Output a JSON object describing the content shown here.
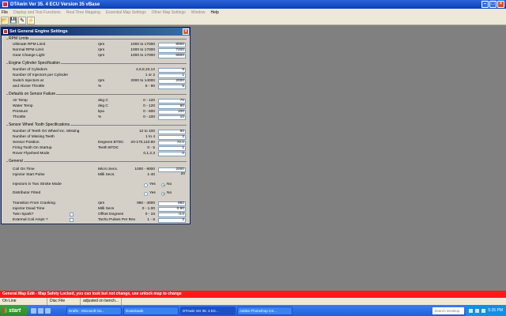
{
  "app": {
    "title": "DTAwin Ver  35. 4 ECU Version  35 vBase",
    "menu": [
      "File",
      "Display and Test Functions",
      "Real Time Mapping",
      "Essential Map Settings",
      "Other Map Settings",
      "Window",
      "Help"
    ],
    "menu_active": [
      true,
      false,
      false,
      false,
      false,
      false,
      true
    ]
  },
  "dialog": {
    "title": "Set General Engine Settings",
    "groups": {
      "rpm": {
        "title": "RPM Limits",
        "rows": [
          {
            "label": "Ultimate RPM Limit",
            "unit": "rpm",
            "range": "1000 to  17000",
            "value": "8000"
          },
          {
            "label": "Normal RPM Limit",
            "unit": "rpm",
            "range": "1000 to  17000",
            "value": "7200"
          },
          {
            "label": "Gear Change Light",
            "unit": "rpm",
            "range": "1000 to  17000",
            "value": "6500"
          }
        ]
      },
      "cyl": {
        "title": "Engine Cylinder Specification",
        "rows": [
          {
            "label": "Number of Cylinders",
            "unit": "",
            "range": "4,6,8,10,12",
            "value": "8"
          },
          {
            "label": "Number Of Injectors per Cylinder",
            "unit": "",
            "range": "1 or 2",
            "value": "1"
          },
          {
            "label": "Switch Injectors at",
            "unit": "rpm",
            "range": "2000 to 14000",
            "value": "2000"
          },
          {
            "label": "and Above Throttle",
            "unit": "%",
            "range": "5 - 90",
            "value": "5"
          }
        ]
      },
      "def": {
        "title": "Defaults on Sensor Failure",
        "rows": [
          {
            "label": "Air Temp",
            "unit": "deg C",
            "range": "0 - 120",
            "value": "70"
          },
          {
            "label": "Water Temp",
            "unit": "deg C",
            "range": "0 - 120",
            "value": "90"
          },
          {
            "label": "Pressure",
            "unit": "kpa",
            "range": "0 - 600",
            "value": "100"
          },
          {
            "label": "Throttle",
            "unit": "%",
            "range": "0 - 100",
            "value": "10"
          }
        ]
      },
      "wheel": {
        "title": "Sensor Wheel Tooth Specifications",
        "rows": [
          {
            "label": "Number of Teeth On Wheel inc. Missing",
            "unit": "",
            "range": "12 to 100",
            "value": "60"
          },
          {
            "label": "Number of Missing Teeth",
            "unit": "",
            "range": "1 to 4",
            "value": "2"
          },
          {
            "label": "Sensor Position",
            "unit": "Degrees BTDC",
            "range": "20-170,110.80",
            "value": "70.0"
          },
          {
            "label": "Firing Tooth On Startup",
            "unit": "Teeth BTDC",
            "range": "0 - 5",
            "value": "1"
          },
          {
            "label": "Rover Flywheel Mode",
            "unit": "",
            "range": "0,1,2,3",
            "value": "0"
          }
        ]
      },
      "general": {
        "title": "General",
        "coil": {
          "label": "Coil On Time",
          "unit": "Micro Secs.",
          "range": "1000 - 9000",
          "value": "2000"
        },
        "start": {
          "label": "Injector Start Pulse",
          "unit": "Milli Secs.",
          "range": "1-40",
          "value": "20"
        },
        "two_stroke": {
          "label": "Injectors in Two Stroke Mode",
          "yes": "Yes",
          "no": "No"
        },
        "distributor": {
          "label": "Distributor Fitted",
          "yes": "Yes",
          "no": "No"
        },
        "cranking": {
          "label": "Transition From Cranking",
          "unit": "rpm",
          "range": "950 - 4000",
          "value": "950"
        },
        "dead": {
          "label": "Injector Dead Time",
          "unit": "Milli Secs",
          "range": "0 - 1.00",
          "value": "0.80"
        },
        "twin": {
          "label": "Twin Spark?",
          "unit": "Offset Degrees",
          "range": "0 - 15",
          "value": "0.0"
        },
        "ext": {
          "label": "External Coil Amps ?",
          "unit": "Tacho Pulses Per Rev",
          "range": "1 - 6",
          "value": "2"
        }
      }
    }
  },
  "warning": "General Map Edit - Map Safety Locked, you can look but not change, use unlock map to change",
  "status": [
    "On Line",
    "Disc File Current",
    "adjusted on bench..."
  ],
  "taskbar": {
    "start": "start",
    "tasks": [
      "Drafts - Microsoft Ou...",
      "Downloads",
      "DTAwin Ver  35. 4 EC...",
      "Adobe Photoshop CS..."
    ],
    "search": "Search Desktop",
    "clock": "5:35 PM"
  }
}
